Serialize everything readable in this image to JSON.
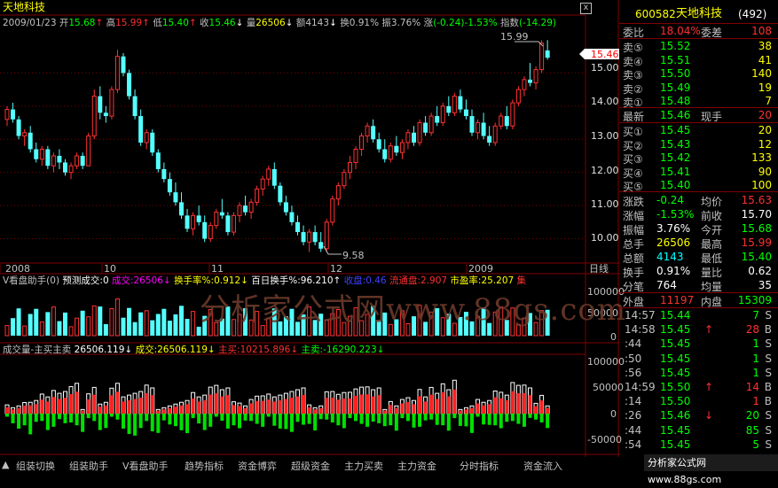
{
  "header": {
    "stock_name": "天地科技",
    "date": "2009/01/23",
    "open_label": "开",
    "open": "15.68",
    "high_label": "高",
    "high": "15.99",
    "low_label": "低",
    "low": "15.40",
    "close_label": "收",
    "close": "15.46",
    "vol_label": "量",
    "vol": "26506",
    "amt_label": "额",
    "amt": "4143",
    "turn_label": "换",
    "turn": "0.91%",
    "amp_label": "振",
    "amp": "3.76%",
    "chg_label": "涨",
    "chg": "(-0.24)-1.53%",
    "index_label": "指数",
    "index": "(-14.29)",
    "close_btn": "x"
  },
  "main_chart": {
    "price_axis": [
      "15.00",
      "14.00",
      "13.00",
      "12.00",
      "11.00",
      "10.00"
    ],
    "current_price_tag": "15.46",
    "max_annot": "15.99",
    "min_annot": "9.58",
    "months": [
      "2008",
      "10",
      "11",
      "12",
      "2009"
    ],
    "period_label": "日线"
  },
  "indicator1": {
    "title": "V看盘助手(0)",
    "items": [
      {
        "label": "预测成交:0",
        "color": "#ffffff"
      },
      {
        "label": "成交:26506↓",
        "color": "#ff00ff"
      },
      {
        "label": "换手率%:0.912↓",
        "color": "#ffff00"
      },
      {
        "label": "百日换手%:96.210↑",
        "color": "#ffffff"
      },
      {
        "label": "收盘:0.46",
        "color": "#4040ff"
      },
      {
        "label": "流通盘:2.907",
        "color": "#ff3030"
      },
      {
        "label": "市盈率:25.207",
        "color": "#ffff00"
      },
      {
        "label": "集",
        "color": "#ff3030"
      }
    ],
    "axis": [
      "100000",
      "50000",
      "0"
    ],
    "watermark": "分析家公式网www.88gs.com"
  },
  "indicator2": {
    "title": "成交量-主买主卖",
    "items": [
      {
        "label": "26506.119↓",
        "color": "#ffffff"
      },
      {
        "label": "成交:26506.119↓",
        "color": "#ffff00"
      },
      {
        "label": "主买:10215.896↓",
        "color": "#ff3030"
      },
      {
        "label": "主卖:-16290.223↓",
        "color": "#00ff00"
      }
    ],
    "axis": [
      "100000",
      "50000",
      "0",
      "-50000"
    ]
  },
  "bottom_tabs": [
    "▲",
    "组装切换",
    "组装助手",
    "V看盘助手",
    "趋势指标",
    "资金博弈",
    "超级资金",
    "主力买卖",
    "主力资金",
    "分时指标",
    "资金流入"
  ],
  "quote_panel": {
    "code": "600582",
    "name": "天地科技",
    "count": "(492)",
    "weibi_label": "委比",
    "weibi": "18.04%",
    "weicha_label": "委差",
    "weicha": "108",
    "asks": [
      {
        "label": "卖⑤",
        "price": "15.52",
        "vol": "38"
      },
      {
        "label": "卖④",
        "price": "15.51",
        "vol": "41"
      },
      {
        "label": "卖③",
        "price": "15.50",
        "vol": "140"
      },
      {
        "label": "卖②",
        "price": "15.49",
        "vol": "19"
      },
      {
        "label": "卖①",
        "price": "15.48",
        "vol": "7"
      }
    ],
    "last_label": "最新",
    "last": "15.46",
    "hand_label": "现手",
    "hand": "20",
    "bids": [
      {
        "label": "买①",
        "price": "15.45",
        "vol": "20"
      },
      {
        "label": "买②",
        "price": "15.43",
        "vol": "12"
      },
      {
        "label": "买③",
        "price": "15.42",
        "vol": "133"
      },
      {
        "label": "买④",
        "price": "15.41",
        "vol": "90"
      },
      {
        "label": "买⑤",
        "price": "15.40",
        "vol": "100"
      }
    ],
    "stats": [
      {
        "l1": "涨跌",
        "v1": "-0.24",
        "c1": "#00ff00",
        "l2": "均价",
        "v2": "15.63",
        "c2": "#ff3030"
      },
      {
        "l1": "涨幅",
        "v1": "-1.53%",
        "c1": "#00ff00",
        "l2": "前收",
        "v2": "15.70",
        "c2": "#ffffff"
      },
      {
        "l1": "振幅",
        "v1": "3.76%",
        "c1": "#ffffff",
        "l2": "今开",
        "v2": "15.68",
        "c2": "#00ff00"
      },
      {
        "l1": "总手",
        "v1": "26506",
        "c1": "#ffff00",
        "l2": "最高",
        "v2": "15.99",
        "c2": "#ff3030"
      },
      {
        "l1": "总额",
        "v1": "4143",
        "c1": "#00ffff",
        "l2": "最低",
        "v2": "15.40",
        "c2": "#00ff00"
      },
      {
        "l1": "换手",
        "v1": "0.91%",
        "c1": "#ffffff",
        "l2": "量比",
        "v2": "0.62",
        "c2": "#ffffff"
      },
      {
        "l1": "分笔",
        "v1": "764",
        "c1": "#ffffff",
        "l2": "均量",
        "v2": "35",
        "c2": "#ffffff"
      }
    ],
    "waipan_label": "外盘",
    "waipan": "11197",
    "neipan_label": "内盘",
    "neipan": "15309",
    "trades": [
      {
        "time": "14:57",
        "price": "15.44",
        "arrow": "",
        "vol": "7",
        "bs": "S",
        "pc": "#00ff00",
        "vc": "#00ff00"
      },
      {
        "time": "14:58",
        "price": "15.45",
        "arrow": "↑",
        "vol": "28",
        "bs": "B",
        "pc": "#00ff00",
        "vc": "#ff3030"
      },
      {
        "time": ":44",
        "price": "15.45",
        "arrow": "",
        "vol": "1",
        "bs": "S",
        "pc": "#00ff00",
        "vc": "#00ff00"
      },
      {
        "time": ":50",
        "price": "15.45",
        "arrow": "",
        "vol": "1",
        "bs": "S",
        "pc": "#00ff00",
        "vc": "#00ff00"
      },
      {
        "time": ":56",
        "price": "15.45",
        "arrow": "",
        "vol": "1",
        "bs": "S",
        "pc": "#00ff00",
        "vc": "#00ff00"
      },
      {
        "time": "14:59",
        "price": "15.50",
        "arrow": "↑",
        "vol": "14",
        "bs": "B",
        "pc": "#00ff00",
        "vc": "#ff3030"
      },
      {
        "time": ":14",
        "price": "15.50",
        "arrow": "",
        "vol": "1",
        "bs": "B",
        "pc": "#00ff00",
        "vc": "#ff3030"
      },
      {
        "time": ":26",
        "price": "15.46",
        "arrow": "↓",
        "vol": "20",
        "bs": "S",
        "pc": "#00ff00",
        "vc": "#00ff00"
      },
      {
        "time": ":44",
        "price": "15.45",
        "arrow": "",
        "vol": "85",
        "bs": "S",
        "pc": "#00ff00",
        "vc": "#00ff00"
      },
      {
        "time": ":54",
        "price": "15.45",
        "arrow": "",
        "vol": "5",
        "bs": "S",
        "pc": "#00ff00",
        "vc": "#00ff00"
      }
    ]
  },
  "footer_badge": "分析家公式网 www.88gs.com",
  "chart_data": {
    "type": "candlestick",
    "title": "天地科技",
    "y_range": [
      9.4,
      16.4
    ],
    "x_ticks": [
      "2008",
      "10",
      "11",
      "12",
      "2009"
    ],
    "candles": [
      [
        13.6,
        14.0,
        13.4,
        13.9
      ],
      [
        13.9,
        14.1,
        13.5,
        13.6
      ],
      [
        13.6,
        13.7,
        13.0,
        13.1
      ],
      [
        13.1,
        13.3,
        12.8,
        13.2
      ],
      [
        13.2,
        13.4,
        12.6,
        12.7
      ],
      [
        12.7,
        12.9,
        12.3,
        12.4
      ],
      [
        12.4,
        12.8,
        12.2,
        12.7
      ],
      [
        12.7,
        12.8,
        12.1,
        12.2
      ],
      [
        12.2,
        12.6,
        12.0,
        12.5
      ],
      [
        12.5,
        12.7,
        12.1,
        12.3
      ],
      [
        12.3,
        12.4,
        11.9,
        12.0
      ],
      [
        12.0,
        12.3,
        11.8,
        12.2
      ],
      [
        12.2,
        12.6,
        12.1,
        12.5
      ],
      [
        12.5,
        12.6,
        12.1,
        12.2
      ],
      [
        12.2,
        13.2,
        12.2,
        13.1
      ],
      [
        13.1,
        14.5,
        13.0,
        14.3
      ],
      [
        14.3,
        14.6,
        13.6,
        13.8
      ],
      [
        13.8,
        14.0,
        13.5,
        13.7
      ],
      [
        13.7,
        14.6,
        13.6,
        14.5
      ],
      [
        14.5,
        15.7,
        14.4,
        15.5
      ],
      [
        15.5,
        15.6,
        14.9,
        15.0
      ],
      [
        15.0,
        15.1,
        14.2,
        14.3
      ],
      [
        14.3,
        14.5,
        13.6,
        13.7
      ],
      [
        13.7,
        13.9,
        12.8,
        12.9
      ],
      [
        12.9,
        13.3,
        12.7,
        13.2
      ],
      [
        13.2,
        13.3,
        12.5,
        12.6
      ],
      [
        12.6,
        12.7,
        12.0,
        12.1
      ],
      [
        12.1,
        12.3,
        11.7,
        11.8
      ],
      [
        11.8,
        12.0,
        11.3,
        11.4
      ],
      [
        11.4,
        11.7,
        11.0,
        11.1
      ],
      [
        11.1,
        11.4,
        10.6,
        10.7
      ],
      [
        10.7,
        10.9,
        10.2,
        10.3
      ],
      [
        10.3,
        10.8,
        10.1,
        10.7
      ],
      [
        10.7,
        11.0,
        10.4,
        10.5
      ],
      [
        10.5,
        10.7,
        9.9,
        10.0
      ],
      [
        10.0,
        10.5,
        9.9,
        10.4
      ],
      [
        10.4,
        10.9,
        10.3,
        10.8
      ],
      [
        10.8,
        11.2,
        10.6,
        10.7
      ],
      [
        10.7,
        10.8,
        10.1,
        10.2
      ],
      [
        10.2,
        10.8,
        10.1,
        10.7
      ],
      [
        10.7,
        11.1,
        10.5,
        11.0
      ],
      [
        11.0,
        11.3,
        10.7,
        10.8
      ],
      [
        10.8,
        11.2,
        10.6,
        11.1
      ],
      [
        11.1,
        11.6,
        11.0,
        11.5
      ],
      [
        11.5,
        11.9,
        11.3,
        11.8
      ],
      [
        11.8,
        12.2,
        11.6,
        12.1
      ],
      [
        12.1,
        12.3,
        11.5,
        11.6
      ],
      [
        11.6,
        11.7,
        11.0,
        11.1
      ],
      [
        11.1,
        11.3,
        10.7,
        10.8
      ],
      [
        10.8,
        11.0,
        10.4,
        10.5
      ],
      [
        10.5,
        10.7,
        10.1,
        10.2
      ],
      [
        10.2,
        10.4,
        9.8,
        9.9
      ],
      [
        9.9,
        10.3,
        9.6,
        10.2
      ],
      [
        10.2,
        10.4,
        9.8,
        9.9
      ],
      [
        9.9,
        10.2,
        9.6,
        9.7
      ],
      [
        9.7,
        10.6,
        9.6,
        10.5
      ],
      [
        10.5,
        11.3,
        10.4,
        11.2
      ],
      [
        11.2,
        11.7,
        11.0,
        11.6
      ],
      [
        11.6,
        12.1,
        11.5,
        12.0
      ],
      [
        12.0,
        12.5,
        11.8,
        12.3
      ],
      [
        12.3,
        12.8,
        12.1,
        12.7
      ],
      [
        12.7,
        13.2,
        12.5,
        13.1
      ],
      [
        13.1,
        13.5,
        12.9,
        13.4
      ],
      [
        13.4,
        13.6,
        12.9,
        13.0
      ],
      [
        13.0,
        13.2,
        12.6,
        12.7
      ],
      [
        12.7,
        13.0,
        12.3,
        12.4
      ],
      [
        12.4,
        12.9,
        12.3,
        12.8
      ],
      [
        12.8,
        13.1,
        12.5,
        12.6
      ],
      [
        12.6,
        13.0,
        12.4,
        12.9
      ],
      [
        12.9,
        13.3,
        12.7,
        13.2
      ],
      [
        13.2,
        13.4,
        12.8,
        12.9
      ],
      [
        12.9,
        13.6,
        12.8,
        13.5
      ],
      [
        13.5,
        13.7,
        13.1,
        13.2
      ],
      [
        13.2,
        13.8,
        13.1,
        13.7
      ],
      [
        13.7,
        14.0,
        13.4,
        13.5
      ],
      [
        13.5,
        14.1,
        13.4,
        14.0
      ],
      [
        14.0,
        14.3,
        13.7,
        13.8
      ],
      [
        13.8,
        14.4,
        13.7,
        14.3
      ],
      [
        14.3,
        14.5,
        13.8,
        13.9
      ],
      [
        13.9,
        14.2,
        13.6,
        13.7
      ],
      [
        13.7,
        13.9,
        13.1,
        13.2
      ],
      [
        13.2,
        13.6,
        13.0,
        13.5
      ],
      [
        13.5,
        13.8,
        13.0,
        13.1
      ],
      [
        13.1,
        13.4,
        12.8,
        12.9
      ],
      [
        12.9,
        13.5,
        12.8,
        13.4
      ],
      [
        13.4,
        13.8,
        13.3,
        13.7
      ],
      [
        13.7,
        14.0,
        13.3,
        13.4
      ],
      [
        13.4,
        14.2,
        13.3,
        14.1
      ],
      [
        14.1,
        14.6,
        14.0,
        14.5
      ],
      [
        14.5,
        14.9,
        14.3,
        14.8
      ],
      [
        14.8,
        15.3,
        14.6,
        14.7
      ],
      [
        14.7,
        15.2,
        14.5,
        15.1
      ],
      [
        15.1,
        15.99,
        15.0,
        15.9
      ],
      [
        15.68,
        15.99,
        15.4,
        15.46
      ]
    ],
    "volume_axis": [
      0,
      100000
    ],
    "mainbuy_axis": [
      -50000,
      100000
    ]
  }
}
